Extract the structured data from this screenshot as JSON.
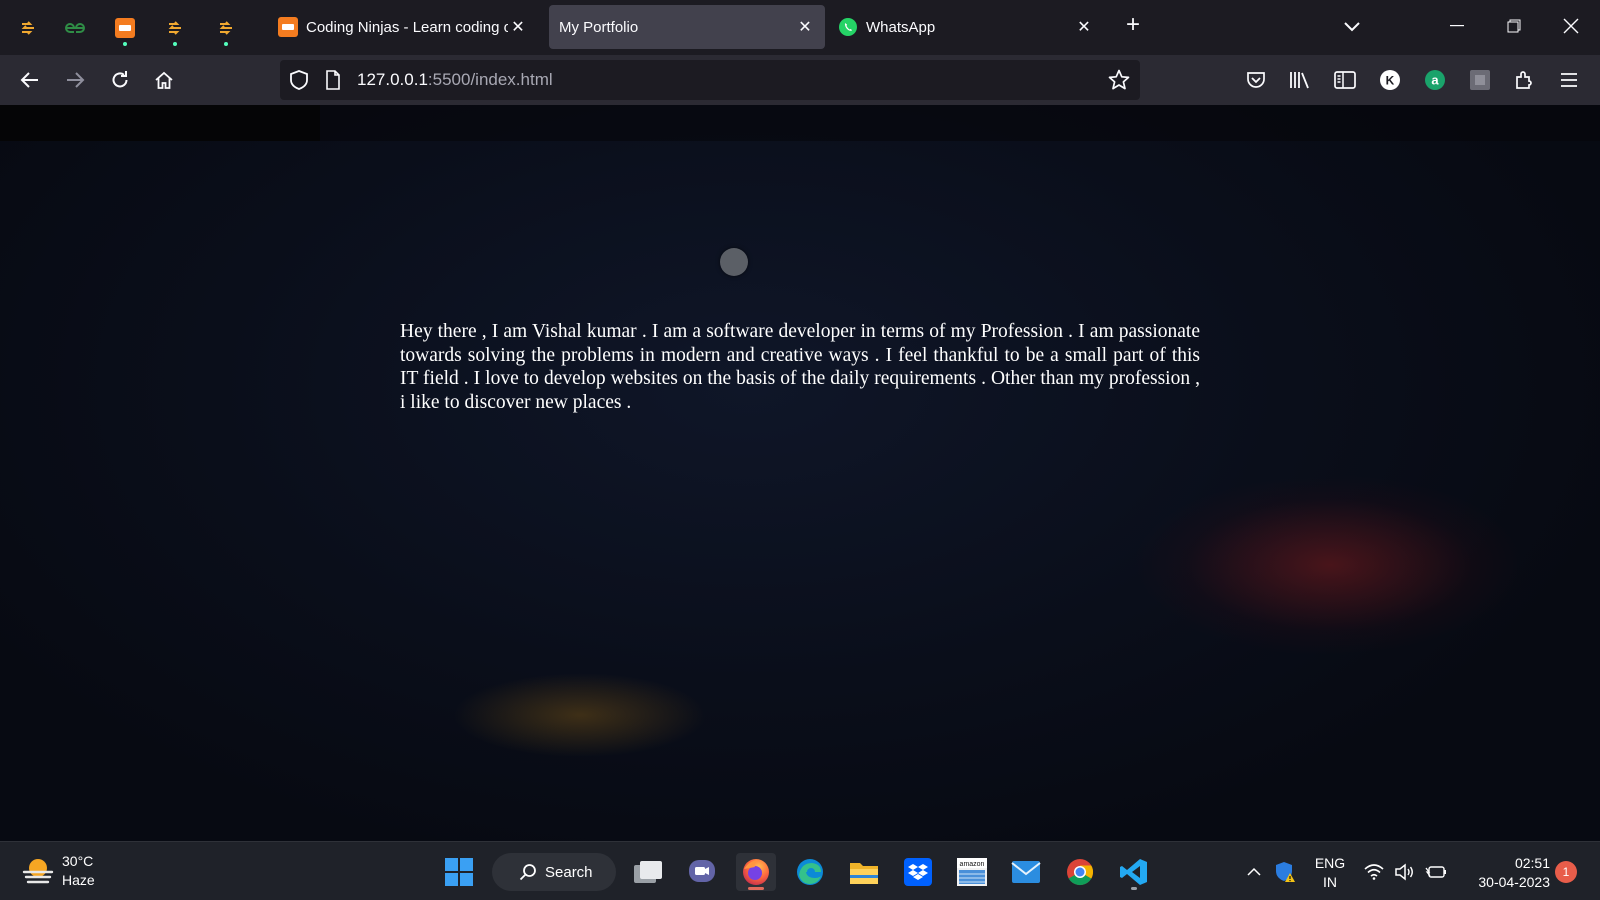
{
  "browser": {
    "pinned_tabs": [
      {
        "icon": "arrow-site-favicon-icon"
      },
      {
        "icon": "geeksforgeeks-favicon-icon"
      },
      {
        "icon": "coding-ninjas-favicon-icon"
      },
      {
        "icon": "arrow-site-favicon-icon"
      },
      {
        "icon": "arrow-site-favicon-icon"
      }
    ],
    "tabs": [
      {
        "title": "Coding Ninjas - Learn coding online",
        "icon": "coding-ninjas-favicon-icon",
        "active": false
      },
      {
        "title": "My Portfolio",
        "icon": "",
        "active": true
      },
      {
        "title": "WhatsApp",
        "icon": "whatsapp-favicon-icon",
        "active": false
      }
    ],
    "url_host": "127.0.0.1",
    "url_rest": ":5500/index.html"
  },
  "page": {
    "about_text": "Hey there , I am Vishal kumar . I am a software developer in terms of my Profession . I am passionate towards solving the problems in modern and creative ways . I feel thankful to be a small part of this IT field . I love to develop websites on the basis of the daily requirements . Other than my profession , i like to discover new places ."
  },
  "taskbar": {
    "weather_temp": "30°C",
    "weather_desc": "Haze",
    "search_label": "Search",
    "lang_line1": "ENG",
    "lang_line2": "IN",
    "time": "02:51",
    "date": "30-04-2023",
    "notification_count": "1"
  },
  "colors": {
    "accent_firefox": "#e06b5b",
    "pinned_dot": "#54ffbd",
    "chrome_dark": "#1c1b22",
    "navbar": "#2b2a33"
  }
}
